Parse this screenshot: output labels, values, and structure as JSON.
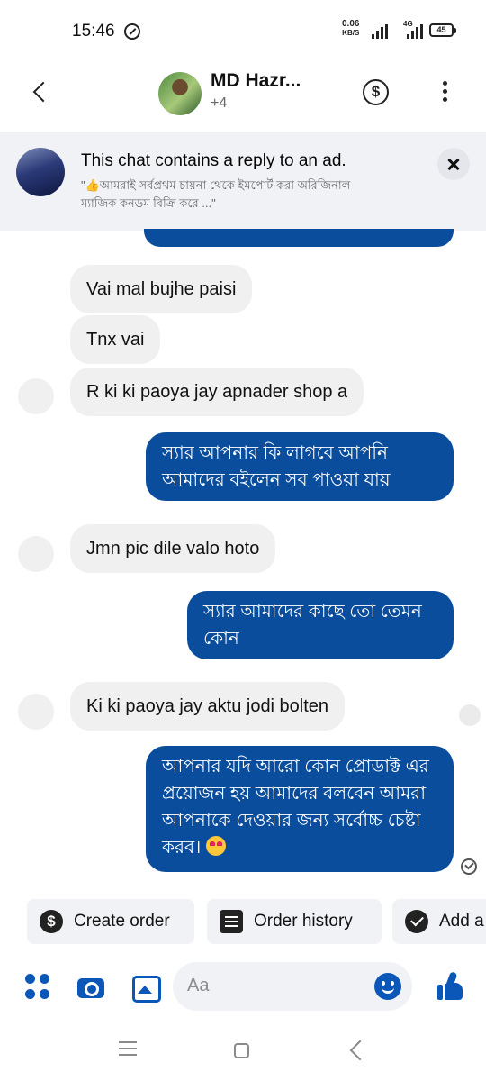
{
  "status_bar": {
    "time": "15:46",
    "net_speed_value": "0.06",
    "net_speed_unit": "KB/S",
    "network_type": "4G",
    "battery": "45"
  },
  "header": {
    "contact_name": "MD Hazr...",
    "participants_extra": "+4",
    "dollar_symbol": "$"
  },
  "ad_banner": {
    "title": "This chat contains a reply to an ad.",
    "quote": "\"👍আমরাই সর্বপ্রথম চায়না থেকে ইমপোর্ট করা অরিজিনাল ম্যাজিক কনডম বিক্রি করে ...\""
  },
  "messages": [
    {
      "direction": "incoming",
      "text": "Vai mal bujhe paisi"
    },
    {
      "direction": "incoming",
      "text": "Tnx vai"
    },
    {
      "direction": "incoming",
      "text": "R ki ki paoya jay apnader shop a"
    },
    {
      "direction": "outgoing",
      "text": "স্যার আপনার কি লাগবে আপনি আমাদের বইলেন সব পাওয়া যায়"
    },
    {
      "direction": "incoming",
      "text": "Jmn pic dile valo hoto"
    },
    {
      "direction": "outgoing",
      "text": "স্যার আমাদের কাছে তো তেমন কোন"
    },
    {
      "direction": "incoming",
      "text": "Ki ki paoya jay aktu jodi bolten"
    },
    {
      "direction": "outgoing",
      "text": "আপনার যদি আরো কোন প্রোডাক্ট এর প্রয়োজন হয় আমাদের বলবেন আমরা আপনাকে দেওয়ার জন্য সর্বোচ্চ চেষ্টা করব।"
    }
  ],
  "quick_actions": [
    {
      "label": "Create order",
      "icon": "dollar-icon"
    },
    {
      "label": "Order history",
      "icon": "list-icon"
    },
    {
      "label": "Add a",
      "icon": "check-circle-icon"
    }
  ],
  "composer": {
    "placeholder": "Aa"
  },
  "icons": {
    "accent": "#0a57b8",
    "bubble_out": "#0a4d9c",
    "bubble_in": "#f0f0f0"
  }
}
